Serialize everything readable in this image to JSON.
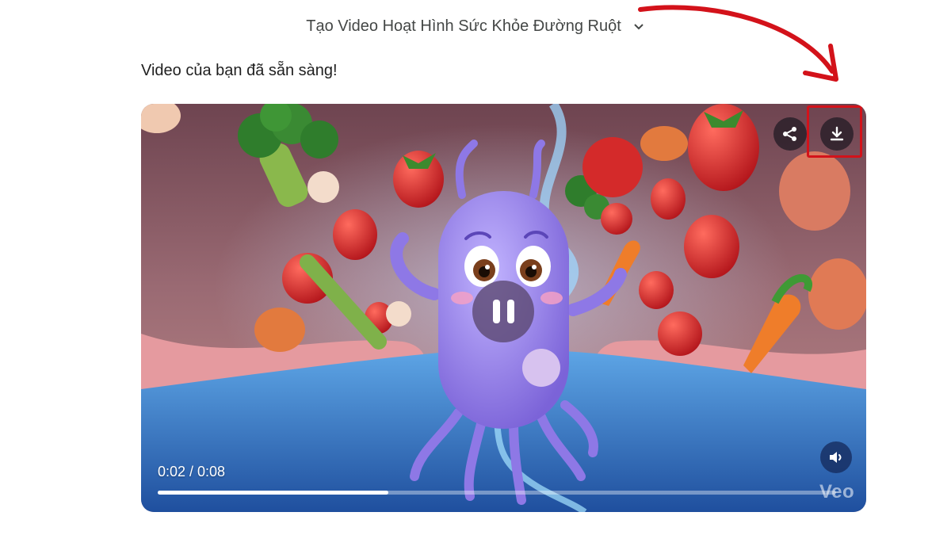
{
  "header": {
    "title": "Tạo Video Hoạt Hình Sức Khỏe Đường Ruột",
    "dropdown_icon": "chevron-down-icon"
  },
  "message": "Video của bạn đã sẵn sàng!",
  "player": {
    "time": "0:02 / 0:08",
    "progress": 0.34,
    "watermark": "Veo",
    "buttons": {
      "share": "share-icon",
      "download": "download-icon",
      "volume": "volume-icon",
      "pause": "pause-icon"
    },
    "highlight_color": "#d3121a"
  }
}
